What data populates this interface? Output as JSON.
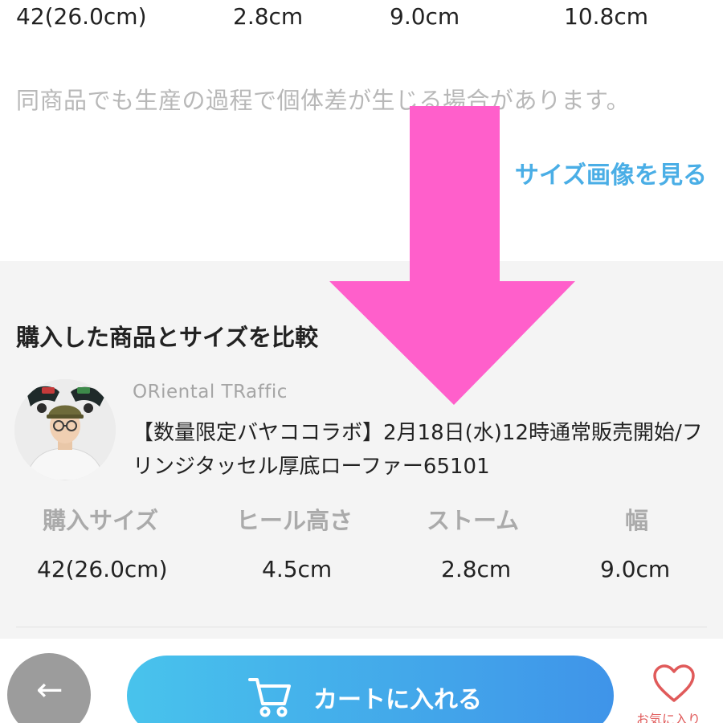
{
  "top_row": {
    "size": "42(26.0cm)",
    "col2": "2.8cm",
    "col3": "9.0cm",
    "col4": "10.8cm"
  },
  "notice": "同商品でも生産の過程で個体差が生じる場合があります。",
  "size_image_link": "サイズ画像を見る",
  "compare": {
    "title": "購入した商品とサイズを比較",
    "brand": "ORiental TRaffic",
    "product_name": "【数量限定バヤココラボ】2月18日(水)12時通常販売開始/フリンジタッセル厚底ローファー65101",
    "headers": [
      "購入サイズ",
      "ヒール高さ",
      "ストーム",
      "幅"
    ],
    "values": [
      "42(26.0cm)",
      "4.5cm",
      "2.8cm",
      "9.0cm"
    ]
  },
  "bottom_bar": {
    "back_icon": "arrow-left-icon",
    "cart_label": "カートに入れる",
    "cart_icon": "cart-icon",
    "favorite_icon": "heart-icon",
    "favorite_label": "お気に入り"
  },
  "colors": {
    "link": "#4aaee6",
    "cart_gradient_start": "#48c3ec",
    "cart_gradient_end": "#3f94e9",
    "overlay_arrow": "#ff5fcb",
    "heart": "#e05a5a"
  }
}
